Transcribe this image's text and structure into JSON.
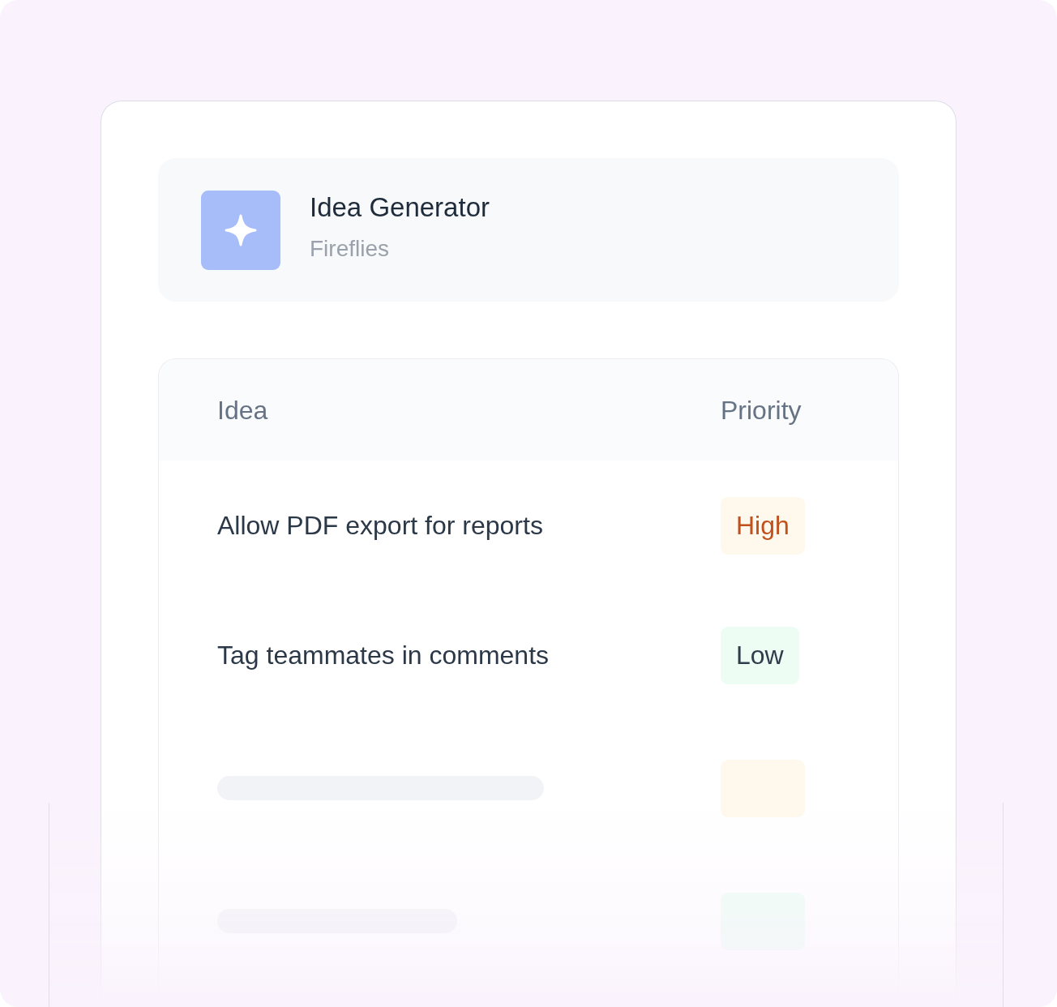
{
  "app": {
    "title": "Idea Generator",
    "subtitle": "Fireflies"
  },
  "table": {
    "columns": [
      "Idea",
      "Priority"
    ],
    "rows": [
      {
        "kind": "entry",
        "idea": "Allow PDF export for reports",
        "priority": {
          "label": "High",
          "color": "#fff8ec",
          "highlighted": true
        }
      },
      {
        "kind": "entry",
        "idea": "Tag teammates in comments",
        "priority": {
          "label": "Low",
          "color": "#edfdf4",
          "highlighted": false
        }
      },
      {
        "kind": "skeleton",
        "priority": {
          "color": "#fff8ec"
        }
      },
      {
        "kind": "skeleton",
        "priority": {
          "color": "#edfdf4"
        }
      }
    ]
  }
}
